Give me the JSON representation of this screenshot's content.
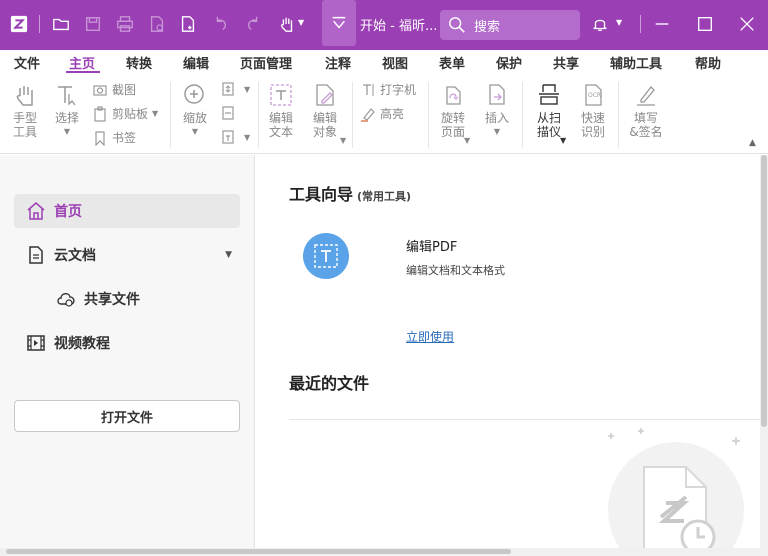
{
  "titlebar": {
    "doc_title": "开始 - 福昕...",
    "search_label": "搜索",
    "accent_color": "#9b3fb5",
    "icons": [
      "app-logo-icon",
      "open-folder-icon",
      "save-icon",
      "print-icon",
      "new-doc-icon",
      "new-file-icon",
      "undo-icon",
      "redo-icon",
      "hand-tool-icon",
      "doc-tab-dropdown-icon",
      "search-icon",
      "bell-icon",
      "minimize-icon",
      "maximize-icon",
      "close-icon"
    ]
  },
  "menu": {
    "items": [
      "文件",
      "主页",
      "转换",
      "编辑",
      "页面管理",
      "注释",
      "视图",
      "表单",
      "保护",
      "共享",
      "辅助工具",
      "帮助"
    ],
    "active": "主页"
  },
  "ribbon": {
    "hand_tool": "手型\n工具",
    "select": "选择",
    "screenshot": "截图",
    "clipboard": "剪贴板",
    "bookmark": "书签",
    "zoom": "缩放",
    "edit_text": "编辑\n文本",
    "edit_object": "编辑\n对象",
    "typewriter": "打字机",
    "highlight": "高亮",
    "rotate_page": "旋转\n页面",
    "insert": "插入",
    "from_scanner": "从扫\n描仪",
    "quick_ocr": "快速\n识别",
    "fill_sign": "填写\n&签名"
  },
  "sidebar": {
    "home": "首页",
    "cloud_docs": "云文档",
    "shared_files": "共享文件",
    "video_tutorials": "视频教程",
    "open_file": "打开文件"
  },
  "main": {
    "tools_title": "工具向导",
    "tools_subtitle": "(常用工具)",
    "tool_name": "编辑PDF",
    "tool_desc": "编辑文档和文本格式",
    "tool_link": "立即使用",
    "recent_title": "最近的文件"
  }
}
